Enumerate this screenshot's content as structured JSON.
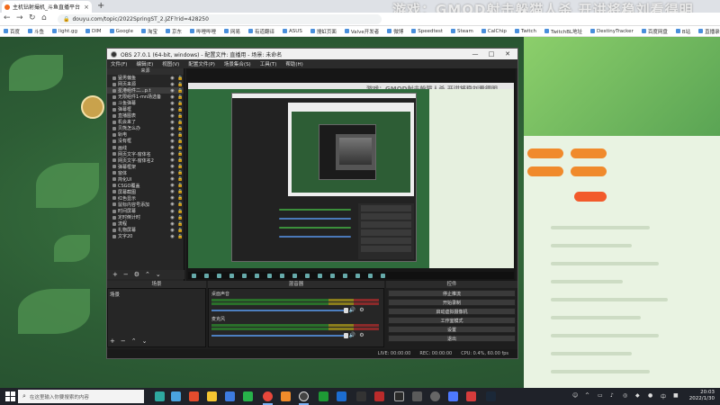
{
  "browser": {
    "tab_title": "主机钻射撮机_斗鱼直播平台",
    "tab_close": "×",
    "new_tab": "+",
    "url": "douyu.com/topic/2022SpringST_2.JZF?rid=428250",
    "banner_text": "游戏：GMOD射击躲猫人杀    开讲将稳刘看得明",
    "bookmarks": [
      "百度",
      "斗鱼",
      "light.gg",
      "DIM",
      "Google",
      "淘宝",
      "京东",
      "哔哩哔哩",
      "网易",
      "有道翻译",
      "ASUS",
      "搜虹页面",
      "Valve开发者",
      "微博",
      "Speedtest",
      "Steam",
      "CalChip",
      "Twitch",
      "TwitchBL地址",
      "DestinyTracker",
      "百度网盘",
      "B站",
      "直播录像"
    ]
  },
  "obs": {
    "title": "OBS 27.0.1 (64-bit, windows) - 配置文件: 直播用 - 场景: 未命名",
    "menu": [
      "文件(F)",
      "编辑(E)",
      "视图(V)",
      "配置文件(P)",
      "场景集合(S)",
      "工具(T)",
      "帮助(H)"
    ],
    "sources_header": "来源",
    "sources": [
      "猛男偏鱼",
      "网页来源",
      "星港组件二...p.t",
      "无限组件1-mn场选备",
      "斗鱼弹幕",
      "弹幕框",
      "直播图表",
      "机会来了",
      "贝熊怎么办",
      "轨电",
      "没有框",
      "画线",
      "网页文字-窗体名",
      "网页文字-窗体名2",
      "弹幕框架",
      "窗体",
      "简化UI",
      "CSGO覆盖",
      "屏幕截图",
      "红色显示",
      "鼠标内容号添加",
      "时间屏幕",
      "定时倒计时",
      "流程",
      "礼物屏幕",
      "文字20"
    ],
    "scenes_header": "场景",
    "scenes": [
      "场景"
    ],
    "mixer_header": "混音器",
    "mixer": [
      {
        "label": "桌面声音",
        "volume": 0.93
      },
      {
        "label": "麦克风",
        "volume": 0.93
      }
    ],
    "controls_header": "控件",
    "controls": [
      "停止推流",
      "开始录制",
      "启动虚拟摄像机",
      "工作室模式",
      "设置",
      "退出"
    ],
    "status": {
      "live": "LIVE: 00:00:00",
      "rec": "REC: 00:00:00",
      "cpu": "CPU: 0.4%, 60.00 fps"
    },
    "nested_banner": "游戏：GMOD射击躲猫人杀   开讲将稳刘看得明"
  },
  "taskbar": {
    "search_placeholder": "在这里输入你要搜索的内容",
    "time": "20:03",
    "date": "2022/1/30"
  }
}
